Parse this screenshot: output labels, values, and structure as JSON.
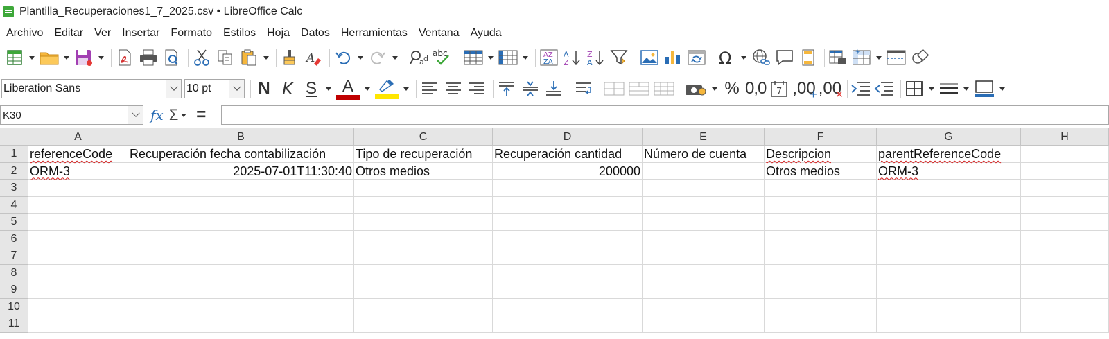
{
  "window": {
    "title": "Plantilla_Recuperaciones1_7_2025.csv • LibreOffice Calc"
  },
  "menu": [
    "Archivo",
    "Editar",
    "Ver",
    "Insertar",
    "Formato",
    "Estilos",
    "Hoja",
    "Datos",
    "Herramientas",
    "Ventana",
    "Ayuda"
  ],
  "format_toolbar": {
    "font_name": "Liberation Sans",
    "font_size": "10 pt",
    "bold_label": "N",
    "italic_label": "K",
    "underline_label": "S",
    "font_color_label": "A",
    "percent_label": "%",
    "decimal_label": "0,0",
    "add_decimal_label": ",00",
    "del_decimal_label": ",00"
  },
  "formula_bar": {
    "cell_ref": "K30",
    "fx_label": "fx",
    "sigma_label": "Σ",
    "equals_label": "=",
    "content": ""
  },
  "colors": {
    "accent": "#2a6db5",
    "font_color_bar": "#c00000",
    "highlight_bar": "#ffe600",
    "header_bg": "#e6e6e6"
  },
  "sheet": {
    "columns": [
      "A",
      "B",
      "C",
      "D",
      "E",
      "F",
      "G",
      "H"
    ],
    "rows": [
      {
        "num": "1",
        "cells": [
          "referenceCode",
          "Recuperación fecha contabilización",
          "Tipo de recuperación",
          "Recuperación cantidad",
          "Número de cuenta",
          "Descripcion",
          "parentReferenceCode",
          ""
        ]
      },
      {
        "num": "2",
        "cells": [
          "ORM-3",
          "2025-07-01T11:30:40",
          "Otros medios",
          "200000",
          "",
          "Otros medios",
          "ORM-3",
          ""
        ]
      },
      {
        "num": "3",
        "cells": [
          "",
          "",
          "",
          "",
          "",
          "",
          "",
          ""
        ]
      },
      {
        "num": "4",
        "cells": [
          "",
          "",
          "",
          "",
          "",
          "",
          "",
          ""
        ]
      },
      {
        "num": "5",
        "cells": [
          "",
          "",
          "",
          "",
          "",
          "",
          "",
          ""
        ]
      },
      {
        "num": "6",
        "cells": [
          "",
          "",
          "",
          "",
          "",
          "",
          "",
          ""
        ]
      },
      {
        "num": "7",
        "cells": [
          "",
          "",
          "",
          "",
          "",
          "",
          "",
          ""
        ]
      },
      {
        "num": "8",
        "cells": [
          "",
          "",
          "",
          "",
          "",
          "",
          "",
          ""
        ]
      },
      {
        "num": "9",
        "cells": [
          "",
          "",
          "",
          "",
          "",
          "",
          "",
          ""
        ]
      },
      {
        "num": "10",
        "cells": [
          "",
          "",
          "",
          "",
          "",
          "",
          "",
          ""
        ]
      },
      {
        "num": "11",
        "cells": [
          "",
          "",
          "",
          "",
          "",
          "",
          "",
          ""
        ]
      }
    ]
  }
}
